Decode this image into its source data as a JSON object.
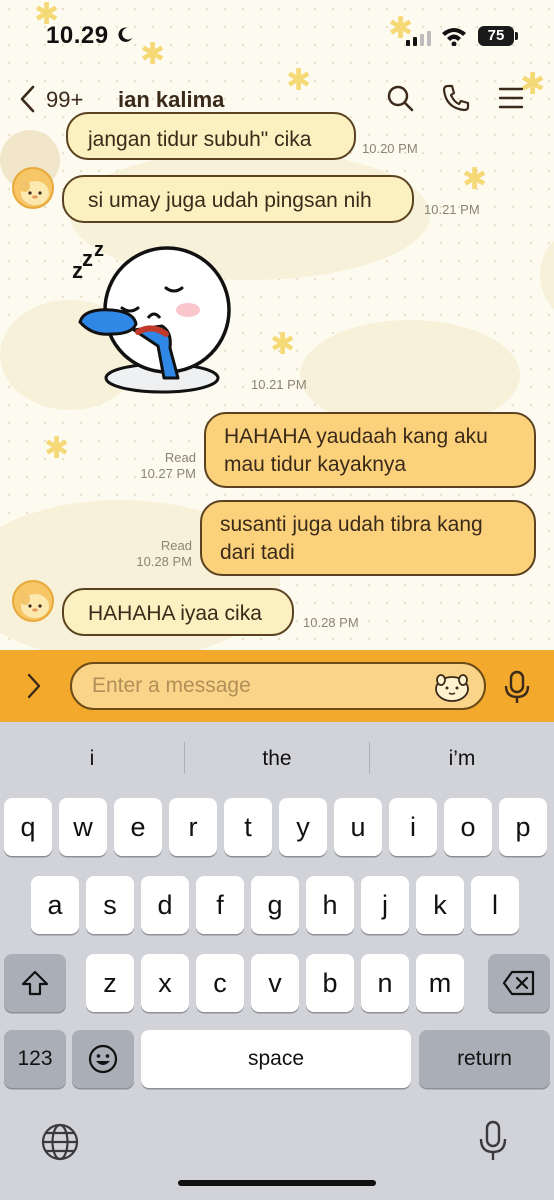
{
  "status_bar": {
    "time": "10.29",
    "battery": "75"
  },
  "header": {
    "unread_count": "99+",
    "title": "ian kalima"
  },
  "messages": [
    {
      "text": "jangan tidur subuh\" cika",
      "time": "10.20 PM"
    },
    {
      "text": "si umay juga udah pingsan nih",
      "time": "10.21 PM"
    },
    {
      "sticker": "sleeping-face-sticker",
      "time": "10.21 PM"
    },
    {
      "line1": "HAHAHA yaudaah kang aku",
      "line2": "mau tidur kayaknya",
      "status": "Read",
      "time": "10.27 PM"
    },
    {
      "line1": "susanti juga udah tibra kang",
      "line2": "dari tadi",
      "status": "Read",
      "time": "10.28 PM"
    },
    {
      "text": "HAHAHA iyaa cika",
      "time": "10.28 PM"
    }
  ],
  "input": {
    "placeholder": "Enter a message"
  },
  "keyboard": {
    "suggestions": [
      "i",
      "the",
      "i’m"
    ],
    "row1": [
      "q",
      "w",
      "e",
      "r",
      "t",
      "y",
      "u",
      "i",
      "o",
      "p"
    ],
    "row2": [
      "a",
      "s",
      "d",
      "f",
      "g",
      "h",
      "j",
      "k",
      "l"
    ],
    "row3": [
      "z",
      "x",
      "c",
      "v",
      "b",
      "n",
      "m"
    ],
    "numbers_label": "123",
    "space_label": "space",
    "return_label": "return"
  },
  "colors": {
    "input_bar": "#f2a92c",
    "bubble_in": "#fbf0bf",
    "bubble_out": "#fbd27b"
  }
}
